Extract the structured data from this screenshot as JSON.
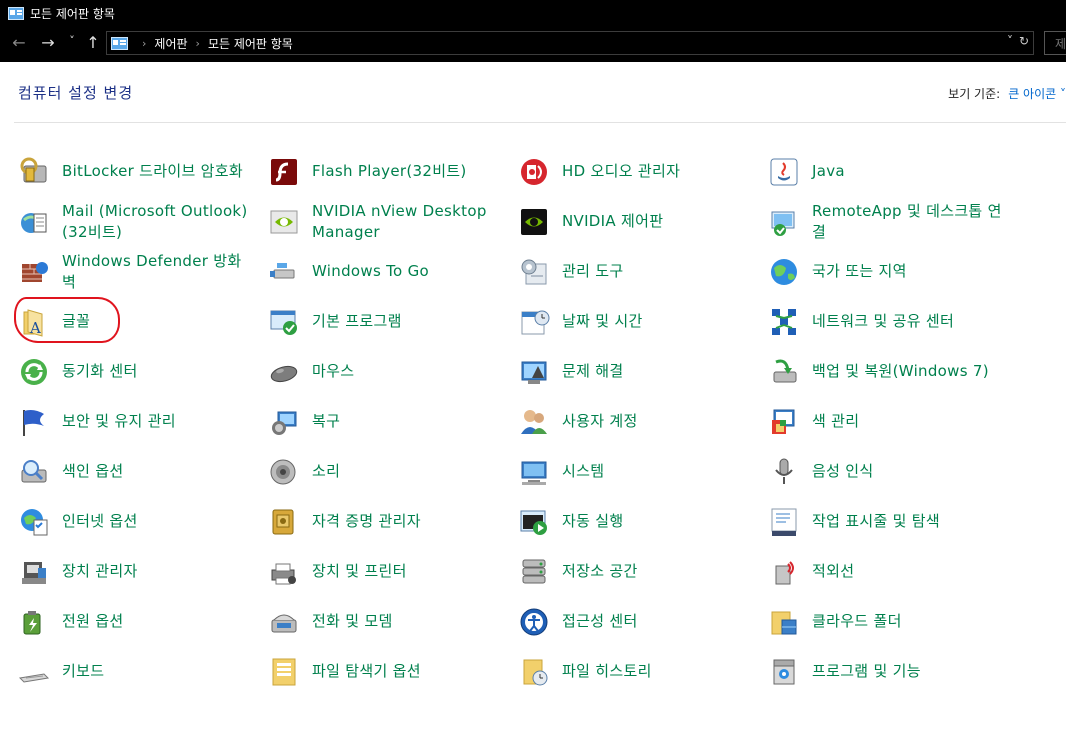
{
  "window": {
    "title": "모든 제어판 항목"
  },
  "nav": {
    "back": "←",
    "forward": "→",
    "dropdown": "˅",
    "up": "↑",
    "breadcrumb": [
      "제어판",
      "모든 제어판 항목"
    ],
    "search_placeholder": "제"
  },
  "header": {
    "title": "컴퓨터 설정 변경",
    "view_by_label": "보기 기준:",
    "view_by_value": "큰 아이콘"
  },
  "columns": [
    [
      {
        "label": "BitLocker 드라이브 암호화",
        "icon": "bitlocker-icon"
      },
      {
        "label": "Mail (Microsoft Outlook)(32비트)",
        "icon": "mail-icon"
      },
      {
        "label": "Windows Defender 방화벽",
        "icon": "firewall-icon"
      },
      {
        "label": "글꼴",
        "icon": "fonts-icon"
      },
      {
        "label": "동기화 센터",
        "icon": "sync-center-icon"
      },
      {
        "label": "보안 및 유지 관리",
        "icon": "security-flag-icon"
      },
      {
        "label": "색인 옵션",
        "icon": "indexing-icon"
      },
      {
        "label": "인터넷 옵션",
        "icon": "internet-options-icon"
      },
      {
        "label": "장치 관리자",
        "icon": "device-manager-icon"
      },
      {
        "label": "전원 옵션",
        "icon": "power-options-icon"
      },
      {
        "label": "키보드",
        "icon": "keyboard-icon"
      }
    ],
    [
      {
        "label": "Flash Player(32비트)",
        "icon": "flash-icon"
      },
      {
        "label": "NVIDIA nView Desktop Manager",
        "icon": "nvidia-nview-icon"
      },
      {
        "label": "Windows To Go",
        "icon": "windows-to-go-icon"
      },
      {
        "label": "기본 프로그램",
        "icon": "default-programs-icon"
      },
      {
        "label": "마우스",
        "icon": "mouse-icon"
      },
      {
        "label": "복구",
        "icon": "recovery-icon"
      },
      {
        "label": "소리",
        "icon": "sound-icon"
      },
      {
        "label": "자격 증명 관리자",
        "icon": "credential-manager-icon"
      },
      {
        "label": "장치 및 프린터",
        "icon": "devices-printers-icon"
      },
      {
        "label": "전화 및 모뎀",
        "icon": "phone-modem-icon"
      },
      {
        "label": "파일 탐색기 옵션",
        "icon": "file-explorer-options-icon"
      }
    ],
    [
      {
        "label": "HD 오디오 관리자",
        "icon": "hd-audio-icon"
      },
      {
        "label": "NVIDIA 제어판",
        "icon": "nvidia-control-panel-icon"
      },
      {
        "label": "관리 도구",
        "icon": "admin-tools-icon"
      },
      {
        "label": "날짜 및 시간",
        "icon": "date-time-icon"
      },
      {
        "label": "문제 해결",
        "icon": "troubleshooting-icon"
      },
      {
        "label": "사용자 계정",
        "icon": "user-accounts-icon"
      },
      {
        "label": "시스템",
        "icon": "system-icon"
      },
      {
        "label": "자동 실행",
        "icon": "autoplay-icon"
      },
      {
        "label": "저장소 공간",
        "icon": "storage-spaces-icon"
      },
      {
        "label": "접근성 센터",
        "icon": "ease-of-access-icon"
      },
      {
        "label": "파일 히스토리",
        "icon": "file-history-icon"
      }
    ],
    [
      {
        "label": "Java",
        "icon": "java-icon"
      },
      {
        "label": "RemoteApp 및 데스크톱 연결",
        "icon": "remoteapp-icon"
      },
      {
        "label": "국가 또는 지역",
        "icon": "region-icon"
      },
      {
        "label": "네트워크 및 공유 센터",
        "icon": "network-sharing-icon"
      },
      {
        "label": "백업 및 복원(Windows 7)",
        "icon": "backup-restore-icon"
      },
      {
        "label": "색 관리",
        "icon": "color-management-icon"
      },
      {
        "label": "음성 인식",
        "icon": "speech-recognition-icon"
      },
      {
        "label": "작업 표시줄 및 탐색",
        "icon": "taskbar-icon"
      },
      {
        "label": "적외선",
        "icon": "infrared-icon"
      },
      {
        "label": "클라우드 폴더",
        "icon": "work-folders-icon"
      },
      {
        "label": "프로그램 및 기능",
        "icon": "programs-features-icon"
      }
    ]
  ],
  "colors": {
    "item_text": "#00804d",
    "header_title": "#1e3287",
    "link": "#0066cc",
    "highlight_circle": "#e0141e",
    "titlebar_bg": "#000000"
  }
}
